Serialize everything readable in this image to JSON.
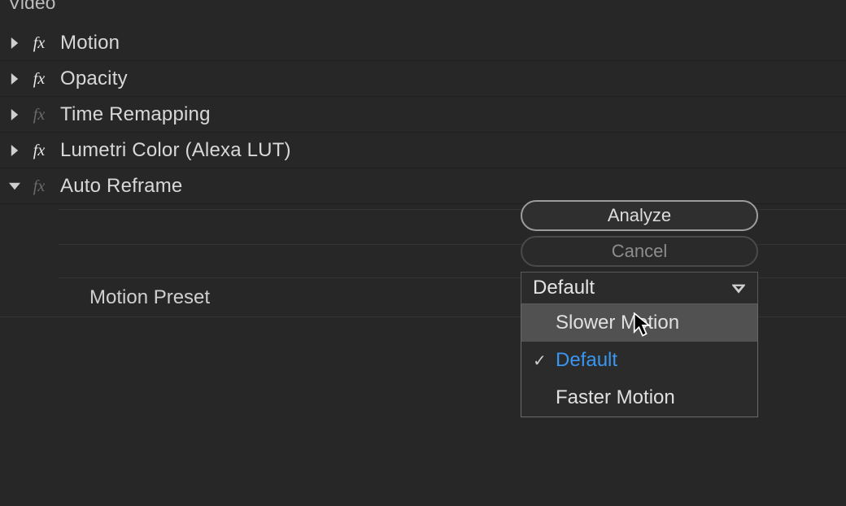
{
  "section": {
    "title": "Video"
  },
  "effects": [
    {
      "name": "Motion",
      "enabled": true,
      "expanded": false
    },
    {
      "name": "Opacity",
      "enabled": true,
      "expanded": false
    },
    {
      "name": "Time Remapping",
      "enabled": false,
      "expanded": false
    },
    {
      "name": "Lumetri Color (Alexa LUT)",
      "enabled": true,
      "expanded": false
    },
    {
      "name": "Auto Reframe",
      "enabled": false,
      "expanded": true
    }
  ],
  "autoReframe": {
    "analyzeLabel": "Analyze",
    "cancelLabel": "Cancel",
    "paramLabel": "Motion Preset",
    "selectedValue": "Default",
    "options": [
      {
        "label": "Slower Motion",
        "selected": false,
        "hover": true
      },
      {
        "label": "Default",
        "selected": true,
        "hover": false
      },
      {
        "label": "Faster Motion",
        "selected": false,
        "hover": false
      }
    ]
  },
  "fxGlyph": "fx",
  "checkGlyph": "✓"
}
